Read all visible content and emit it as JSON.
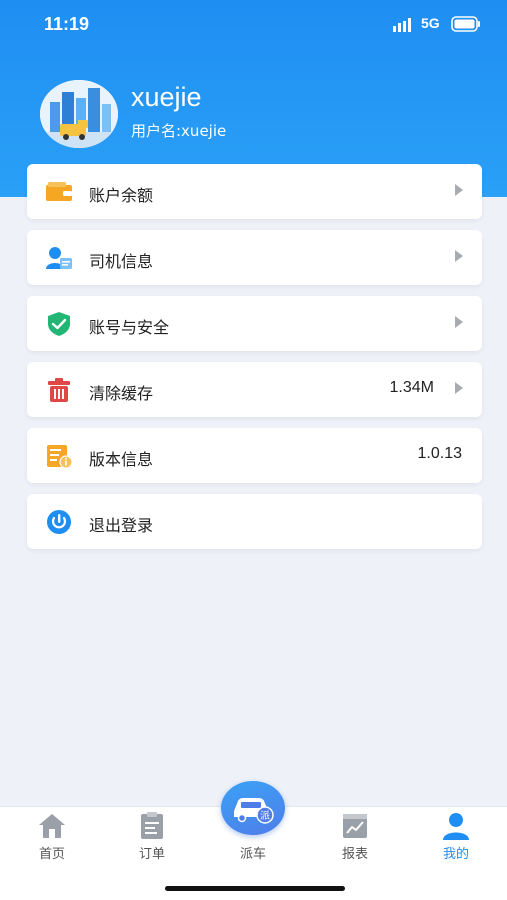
{
  "status_bar": {
    "time": "11:19",
    "network": "5G"
  },
  "profile": {
    "name": "xuejie",
    "subtitle": "用户名:xuejie"
  },
  "menu": [
    {
      "label": "账户余额",
      "value": "",
      "icon": "wallet-icon",
      "arrow": true
    },
    {
      "label": "司机信息",
      "value": "",
      "icon": "driver-info-icon",
      "arrow": true
    },
    {
      "label": "账号与安全",
      "value": "",
      "icon": "shield-check-icon",
      "arrow": true
    },
    {
      "label": "清除缓存",
      "value": "1.34M",
      "icon": "trash-icon",
      "arrow": true
    },
    {
      "label": "版本信息",
      "value": "1.0.13",
      "icon": "version-info-icon",
      "arrow": false
    },
    {
      "label": "退出登录",
      "value": "",
      "icon": "logout-icon",
      "arrow": false
    }
  ],
  "tabs": [
    {
      "label": "首页",
      "icon": "home-icon",
      "active": false
    },
    {
      "label": "订单",
      "icon": "order-icon",
      "active": false
    },
    {
      "label": "派车",
      "icon": "dispatch-car-icon",
      "active": false,
      "badge": "派"
    },
    {
      "label": "报表",
      "icon": "report-icon",
      "active": false
    },
    {
      "label": "我的",
      "icon": "profile-icon",
      "active": true
    }
  ],
  "colors": {
    "primary": "#1f8ef3",
    "background": "#eef2f8",
    "wallet": "#f5a623",
    "shield": "#22b573",
    "trash": "#e04848",
    "tab_inactive": "#9aa0a8"
  }
}
